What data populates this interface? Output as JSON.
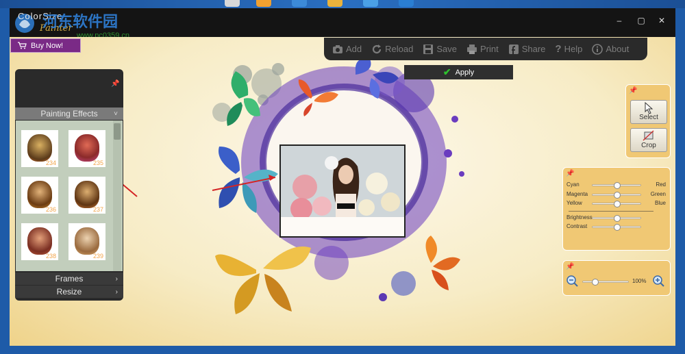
{
  "window": {
    "logo_text": "ColorSize",
    "logo_sub": "Painter",
    "watermark": "河东软件园",
    "watermark_sub": "www.pc0359.cn",
    "minimize": "–",
    "maximize": "▢",
    "close": "✕"
  },
  "buy_now": "Buy Now!",
  "toolbar": {
    "add": "Add",
    "reload": "Reload",
    "save": "Save",
    "print": "Print",
    "share": "Share",
    "help": "Help",
    "about": "About"
  },
  "apply": "Apply",
  "left_panel": {
    "painting_effects": "Painting Effects",
    "frames": "Frames",
    "resize": "Resize",
    "thumbnails": [
      {
        "number": "234"
      },
      {
        "number": "235"
      },
      {
        "number": "236"
      },
      {
        "number": "237"
      },
      {
        "number": "238"
      },
      {
        "number": "239"
      }
    ]
  },
  "tools": {
    "select": "Select",
    "crop": "Crop"
  },
  "color_panel": {
    "cyan": "Cyan",
    "red": "Red",
    "magenta": "Magenta",
    "green": "Green",
    "yellow": "Yellow",
    "blue": "Blue",
    "brightness": "Brightness",
    "contrast": "Contrast"
  },
  "zoom": {
    "level": "100%"
  },
  "colors": {
    "accent_purple": "#7a2a86",
    "panel_gold": "#f0c874",
    "arrow_red": "#d42424"
  }
}
